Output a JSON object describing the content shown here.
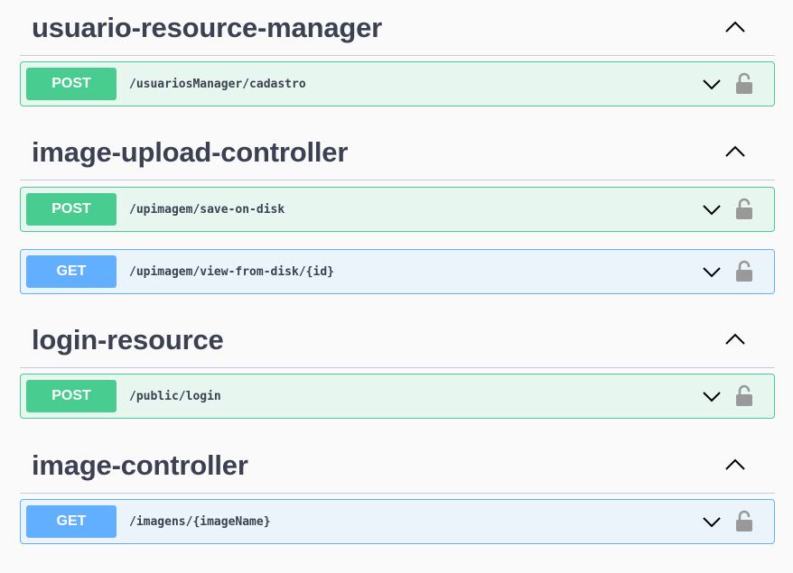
{
  "sections": [
    {
      "title": "usuario-resource-manager",
      "operations": [
        {
          "method": "POST",
          "path": "/usuariosManager/cadastro"
        }
      ]
    },
    {
      "title": "image-upload-controller",
      "operations": [
        {
          "method": "POST",
          "path": "/upimagem/save-on-disk"
        },
        {
          "method": "GET",
          "path": "/upimagem/view-from-disk/{id}"
        }
      ]
    },
    {
      "title": "login-resource",
      "operations": [
        {
          "method": "POST",
          "path": "/public/login"
        }
      ]
    },
    {
      "title": "image-controller",
      "operations": [
        {
          "method": "GET",
          "path": "/imagens/{imageName}"
        }
      ]
    }
  ],
  "icons": {
    "collapse": "chevron-up-icon",
    "expand": "chevron-down-icon",
    "auth": "lock-icon"
  },
  "colors": {
    "post": "#49cc90",
    "post_bg": "#e8f6f0",
    "get": "#61affe",
    "get_bg": "#ebf3fb",
    "title": "#3b4151",
    "lock": "#999999"
  }
}
